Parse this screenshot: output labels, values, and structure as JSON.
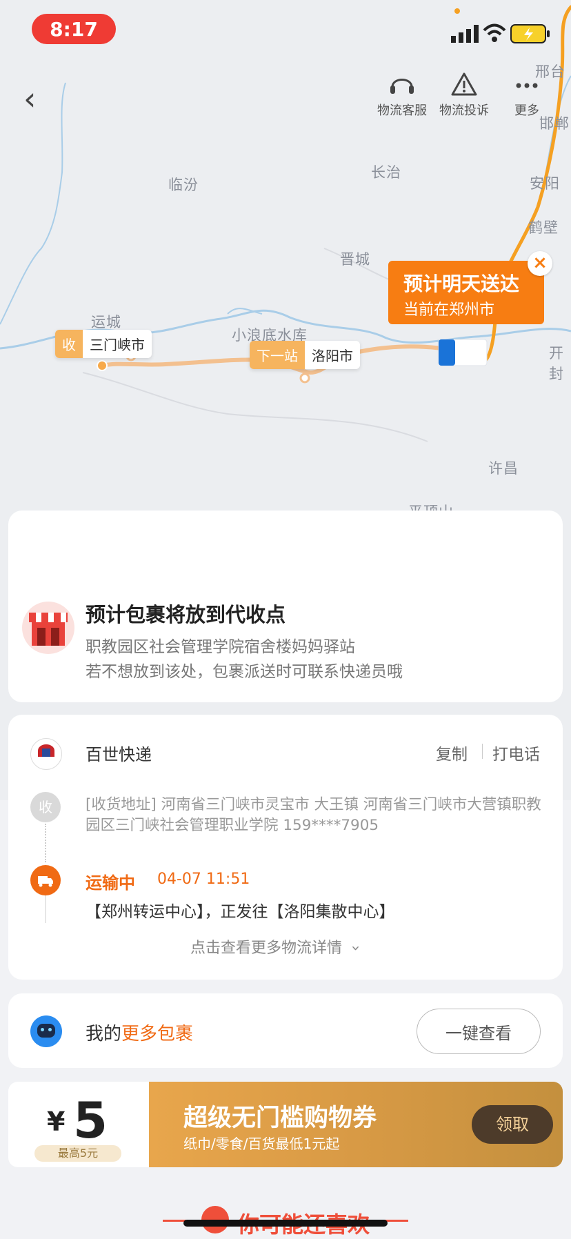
{
  "status": {
    "time": "8:17"
  },
  "toolbar": {
    "service_label": "物流客服",
    "complaint_label": "物流投诉",
    "more_label": "更多"
  },
  "map": {
    "cities": [
      "临汾",
      "长治",
      "晋城",
      "运城",
      "小浪底水库",
      "许昌",
      "平顶山",
      "安阳",
      "鹤壁",
      "邢台",
      "邯郸",
      "开封"
    ],
    "receive_tag": "收",
    "receive_city": "三门峡市",
    "next_tag": "下一站",
    "next_city": "洛阳市",
    "eta_title": "预计明天送达",
    "eta_subtitle": "当前在郑州市"
  },
  "pickup": {
    "title": "预计包裹将放到代收点",
    "line1": "职教园区社会管理学院宿舍楼妈妈驿站",
    "line2": "若不想放到该处，包裹派送时可联系快递员哦"
  },
  "tracking": {
    "carrier": "百世快递",
    "copy_label": "复制",
    "call_label": "打电话",
    "receive_icon_text": "收",
    "address": "[收货地址] 河南省三门峡市灵宝市 大王镇  河南省三门峡市大营镇职教园区三门峡社会管理职业学院 159****7905",
    "status_label": "运输中",
    "status_time": "04-07 11:51",
    "status_detail": "【郑州转运中心】，正发往【洛阳集散中心】",
    "more_details": "点击查看更多物流详情"
  },
  "packages": {
    "prefix": "我的",
    "highlight": "更多包裹",
    "button": "一键查看"
  },
  "coupon": {
    "currency": "¥",
    "amount": "5",
    "max_label": "最高5元",
    "title": "超级无门槛购物券",
    "subtitle": "纸巾/零食/百货最低1元起",
    "button": "领取"
  },
  "recommend": {
    "title": "你可能还喜欢"
  },
  "colors": {
    "accent": "#f77d12",
    "status_red": "#ef3b34"
  }
}
